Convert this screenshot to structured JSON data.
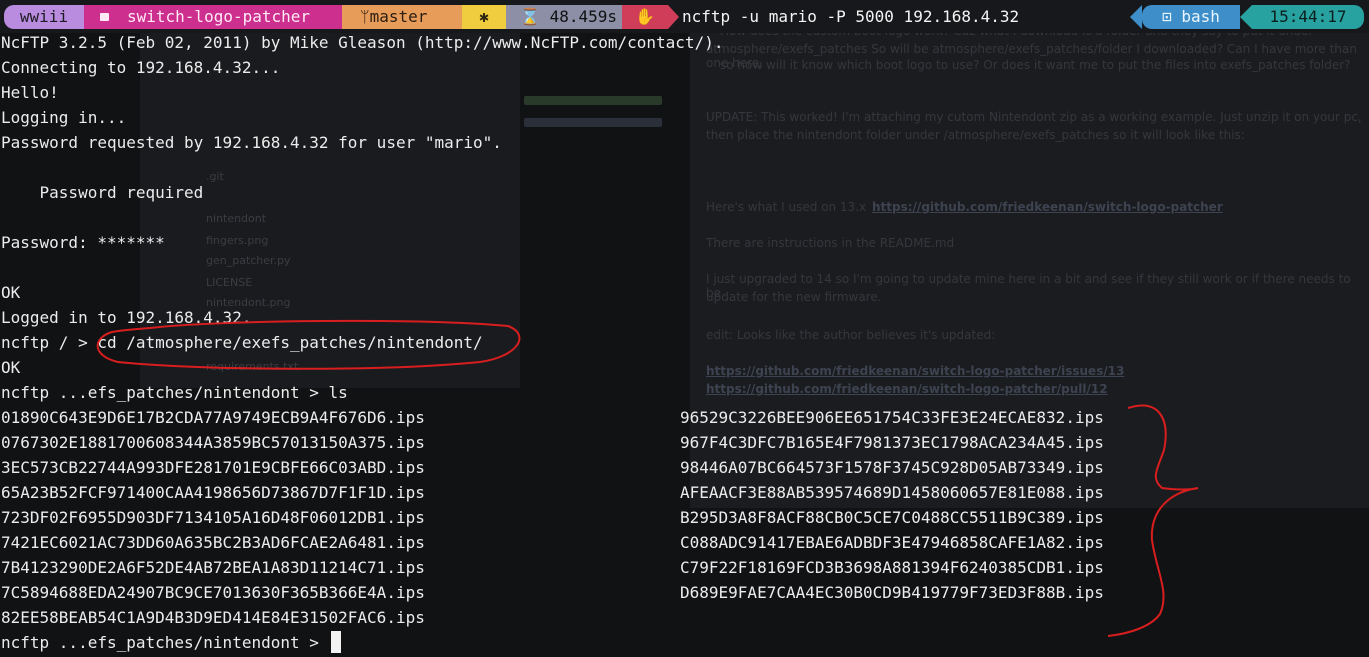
{
  "topbar": {
    "host": "wwiii",
    "directory": "switch-logo-patcher",
    "git_branch": "ᛘmaster",
    "duration": "48.459s",
    "command": "ncftp -u mario -P 5000 192.168.4.32",
    "shell": "bash",
    "clock": "15:44:17"
  },
  "terminal": {
    "banner": "NcFTP 3.2.5 (Feb 02, 2011) by Mike Gleason (http://www.NcFTP.com/contact/).",
    "connecting": "Connecting to 192.168.4.32...",
    "hello": "Hello!",
    "logging": "Logging in...",
    "pw_requested": "Password requested by 192.168.4.32 for user \"mario\".",
    "pw_required": "    Password required",
    "pw_prompt": "Password: *******",
    "ok1": "OK",
    "logged": "Logged in to 192.168.4.32.",
    "cd_prompt": "ncftp / > ",
    "cd_cmd": "cd /atmosphere/exefs_patches/nintendont/",
    "ok2": "OK",
    "ls_line": "ncftp ...efs_patches/nintendont > ls",
    "final_prompt": "ncftp ...efs_patches/nintendont > "
  },
  "files_left": [
    "01890C643E9D6E17B2CDA77A9749ECB9A4F676D6.ips",
    "0767302E1881700608344A3859BC57013150A375.ips",
    "3EC573CB22744A993DFE281701E9CBFE66C03ABD.ips",
    "65A23B52FCF971400CAA4198656D73867D7F1F1D.ips",
    "723DF02F6955D903DF7134105A16D48F06012DB1.ips",
    "7421EC6021AC73DD60A635BC2B3AD6FCAE2A6481.ips",
    "7B4123290DE2A6F52DE4AB72BEA1A83D11214C71.ips",
    "7C5894688EDA24907BC9CE7013630F365B366E4A.ips",
    "82EE58BEAB54C1A9D4B3D9ED414E84E31502FAC6.ips"
  ],
  "files_right": [
    "96529C3226BEE906EE651754C33FE3E24ECAE832.ips",
    "967F4C3DFC7B165E4F7981373EC1798ACA234A45.ips",
    "98446A07BC664573F1578F3745C928D05AB73349.ips",
    "AFEAACF3E88AB539574689D1458060657E81E088.ips",
    "B295D3A8F8ACF88CB0C5CE7C0488CC5511B9C389.ips",
    "C088ADC91417EBAE6ADBDF3E47946858CAFE1A82.ips",
    "C79F22F18169FCD3B3698A881394F6240385CDB1.ips",
    "D689E9FAE7CAA4EC30B0CD9B419779F73ED3F88B.ips"
  ],
  "ghost": {
    "file_names": [
      ".git",
      "nintendont",
      "fingers.png",
      "gen_patcher.py",
      "LICENSE",
      "nintendont.png",
      "requirements.txt"
    ],
    "doc_text_1": "How does the custom boot logo work? Cuz what I download is a folder and they say to put it under",
    "doc_text_2": "atmosphere/exefs_patches So will be atmosphere/exefs_patches/folder I downloaded? Can I have more than one here,",
    "doc_text_3": "so how will it know which boot logo to use? Or does it want me to put the files into exefs_patches folder?",
    "doc_update_1": "UPDATE: This worked! I'm attaching my cutom Nintendont zip as a working example. Just unzip it on your pc,",
    "doc_update_2": "then place the nintendont folder under /atmosphere/exefs_patches so it will look like this:",
    "doc_used": "Here's what I used on 13.x",
    "doc_link_1": "https://github.com/friedkeenan/switch-logo-patcher",
    "doc_readme": "There are instructions in the README.md",
    "doc_upgraded_1": "I just upgraded to 14 so I'm going to update mine here in a bit and see if they still work or if there needs to be",
    "doc_upgraded_2": "update for the new firmware.",
    "doc_edit": "edit: Looks like the author believes it's updated:",
    "doc_link_2": "https://github.com/friedkeenan/switch-logo-patcher/issues/13",
    "doc_link_3": "https://github.com/friedkeenan/switch-logo-patcher/pull/12"
  },
  "colors": {
    "annotation": "#d81e1e"
  }
}
